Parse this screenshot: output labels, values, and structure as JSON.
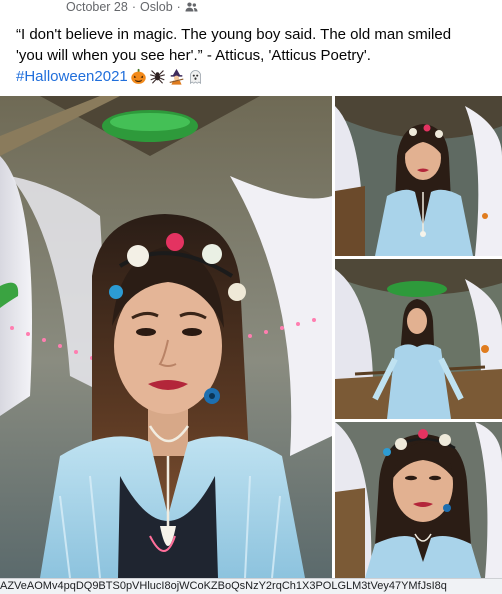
{
  "post": {
    "date": "October 28",
    "separator": "·",
    "location": "Oslob",
    "audience_icon": "friends-icon",
    "caption_line1": "“I don't believe in magic. The young boy said. The old man smiled",
    "caption_line2": "'you will when you see her'.” - Atticus, 'Atticus Poetry'.",
    "hashtag": "#Halloween2021",
    "emojis": [
      "jack-o-lantern-icon",
      "spider-icon",
      "witch-icon",
      "ghost-icon"
    ]
  },
  "photos": {
    "count": 4,
    "main_label": "photo-1",
    "side_labels": [
      "photo-2",
      "photo-3",
      "photo-4"
    ]
  },
  "status_bar": {
    "url_text": "AZVeAOMv4pqDQ9BTS0pVHlucI8ojWCoKZBoQsNzY2rqCh1X3POLGLM3tVey47YMfJsI8q"
  },
  "colors": {
    "hashtag": "#216fdb",
    "meta_text": "#65676b",
    "dress": "#a9d3ea",
    "lights": "#ff7eb0"
  }
}
